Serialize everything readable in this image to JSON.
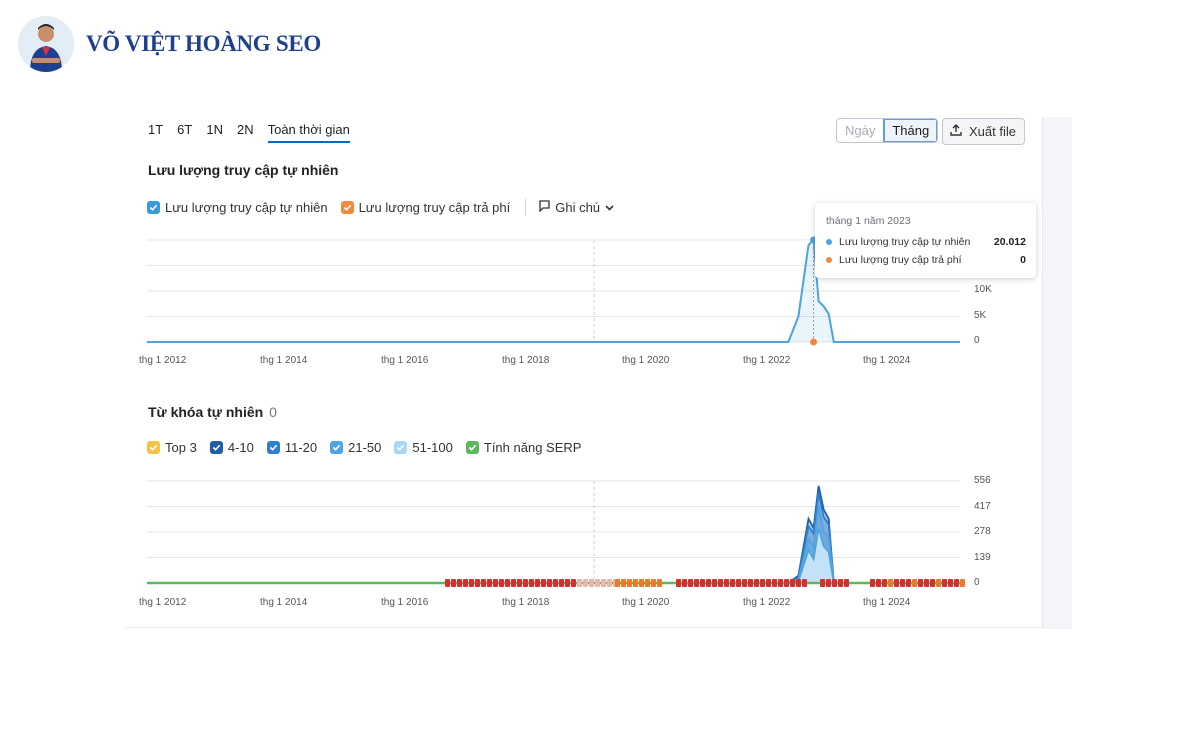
{
  "brand": {
    "name": "VÕ VIỆT HOÀNG SEO"
  },
  "period_tabs": [
    "1T",
    "6T",
    "1N",
    "2N",
    "Toàn thời gian"
  ],
  "active_tab": "Toàn thời gian",
  "granularity": {
    "day": "Ngày",
    "month": "Tháng",
    "selected": "Tháng"
  },
  "export": {
    "label": "Xuất file",
    "icon": "upload-icon"
  },
  "traffic": {
    "title": "Lưu lượng truy cập tự nhiên",
    "legend": {
      "organic": "Lưu lượng truy cập tự nhiên",
      "paid": "Lưu lượng truy cập trả phí",
      "notes": "Ghi chú"
    }
  },
  "tooltip": {
    "date": "tháng 1 năm 2023",
    "organic_label": "Lưu lượng truy cập tự nhiên",
    "organic_value": "20.012",
    "paid_label": "Lưu lượng truy cập trả phí",
    "paid_value": "0"
  },
  "keywords": {
    "title": "Từ khóa tự nhiên",
    "count": "0",
    "legend": {
      "top3": "Top 3",
      "r4_10": "4-10",
      "r11_20": "11-20",
      "r21_50": "21-50",
      "r51_100": "51-100",
      "serp": "Tính năng SERP"
    }
  },
  "colors": {
    "organic": "#4da3dc",
    "paid": "#f08a3c",
    "top3": "#f5c343",
    "r4_10": "#1e5fa8",
    "r11_20": "#2f7fd0",
    "r21_50": "#4fa3e0",
    "r51_100": "#a8d6f5",
    "serp": "#5cb85c"
  },
  "chart_data": [
    {
      "type": "line",
      "title": "Lưu lượng truy cập tự nhiên",
      "x_ticks": [
        "thg 1 2012",
        "thg 1 2014",
        "thg 1 2016",
        "thg 1 2018",
        "thg 1 2020",
        "thg 1 2022",
        "thg 1 2024"
      ],
      "y_ticks": [
        "0",
        "5K",
        "10K"
      ],
      "ylim": [
        0,
        20000
      ],
      "series": [
        {
          "name": "Lưu lượng truy cập tự nhiên",
          "points": [
            [
              "2012-01",
              0
            ],
            [
              "2022-08",
              0
            ],
            [
              "2022-10",
              5000
            ],
            [
              "2022-12",
              19000
            ],
            [
              "2023-01",
              20012
            ],
            [
              "2023-02",
              8000
            ],
            [
              "2023-03",
              7000
            ],
            [
              "2023-04",
              5500
            ],
            [
              "2023-05",
              0
            ],
            [
              "2025-06",
              0
            ]
          ]
        },
        {
          "name": "Lưu lượng truy cập trả phí",
          "points": [
            [
              "2012-01",
              0
            ],
            [
              "2023-01",
              0
            ],
            [
              "2025-06",
              0
            ]
          ]
        }
      ]
    },
    {
      "type": "area",
      "title": "Từ khóa tự nhiên",
      "x_ticks": [
        "thg 1 2012",
        "thg 1 2014",
        "thg 1 2016",
        "thg 1 2018",
        "thg 1 2020",
        "thg 1 2022",
        "thg 1 2024"
      ],
      "y_ticks": [
        "0",
        "139",
        "278",
        "417",
        "556"
      ],
      "ylim": [
        0,
        556
      ],
      "series": [
        {
          "name": "4-10",
          "points": [
            [
              "2012-01",
              0
            ],
            [
              "2022-08",
              0
            ],
            [
              "2022-10",
              40
            ],
            [
              "2022-12",
              350
            ],
            [
              "2023-01",
              300
            ],
            [
              "2023-02",
              530
            ],
            [
              "2023-03",
              400
            ],
            [
              "2023-04",
              350
            ],
            [
              "2023-05",
              0
            ],
            [
              "2025-06",
              0
            ]
          ]
        },
        {
          "name": "11-20",
          "points": [
            [
              "2012-01",
              0
            ],
            [
              "2022-08",
              0
            ],
            [
              "2022-10",
              30
            ],
            [
              "2022-12",
              310
            ],
            [
              "2023-01",
              270
            ],
            [
              "2023-02",
              490
            ],
            [
              "2023-03",
              360
            ],
            [
              "2023-04",
              320
            ],
            [
              "2023-05",
              0
            ],
            [
              "2025-06",
              0
            ]
          ]
        },
        {
          "name": "21-50",
          "points": [
            [
              "2012-01",
              0
            ],
            [
              "2022-08",
              0
            ],
            [
              "2022-10",
              20
            ],
            [
              "2022-12",
              240
            ],
            [
              "2023-01",
              200
            ],
            [
              "2023-02",
              420
            ],
            [
              "2023-03",
              280
            ],
            [
              "2023-04",
              250
            ],
            [
              "2023-05",
              0
            ],
            [
              "2025-06",
              0
            ]
          ]
        },
        {
          "name": "51-100",
          "points": [
            [
              "2012-01",
              0
            ],
            [
              "2022-08",
              0
            ],
            [
              "2022-10",
              10
            ],
            [
              "2022-12",
              180
            ],
            [
              "2023-01",
              130
            ],
            [
              "2023-02",
              300
            ],
            [
              "2023-03",
              200
            ],
            [
              "2023-04",
              170
            ],
            [
              "2023-05",
              0
            ],
            [
              "2025-06",
              0
            ]
          ]
        }
      ]
    }
  ]
}
